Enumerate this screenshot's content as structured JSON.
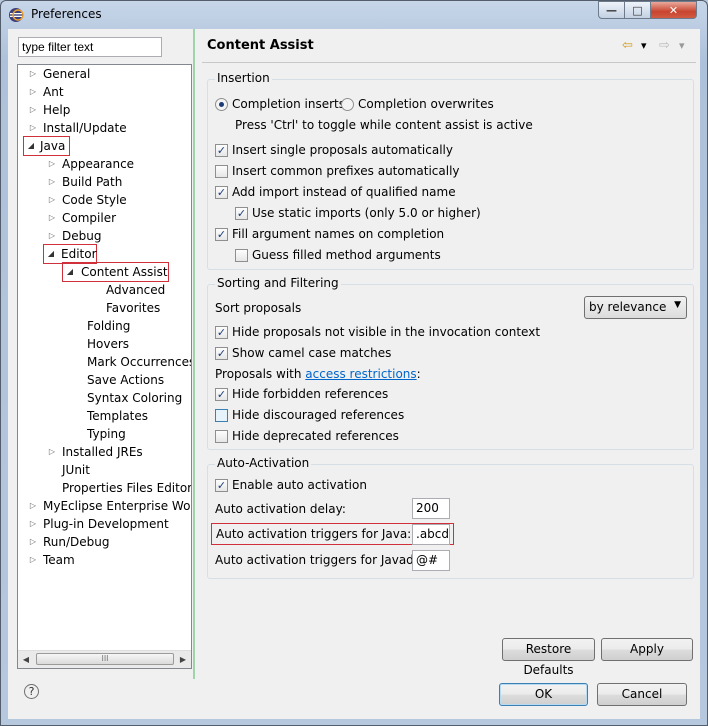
{
  "window": {
    "title": "Preferences",
    "minimize": "—",
    "maximize": "□",
    "close": "✕"
  },
  "filter": {
    "placeholder": "type filter text"
  },
  "tree": {
    "general": "General",
    "ant": "Ant",
    "help": "Help",
    "install_update": "Install/Update",
    "java": "Java",
    "appearance": "Appearance",
    "build_path": "Build Path",
    "code_style": "Code Style",
    "compiler": "Compiler",
    "debug": "Debug",
    "editor": "Editor",
    "content_assist": "Content Assist",
    "advanced": "Advanced",
    "favorites": "Favorites",
    "folding": "Folding",
    "hovers": "Hovers",
    "mark_occurrences": "Mark Occurrences",
    "save_actions": "Save Actions",
    "syntax_coloring": "Syntax Coloring",
    "templates": "Templates",
    "typing": "Typing",
    "installed_jres": "Installed JREs",
    "junit": "JUnit",
    "properties_files_editor": "Properties Files Editor",
    "myeclipse": "MyEclipse Enterprise Workbe",
    "plugin_development": "Plug-in Development",
    "run_debug": "Run/Debug",
    "team": "Team",
    "scroll_grip": "III"
  },
  "page": {
    "title": "Content Assist",
    "back": "⇦",
    "forward": "⇨",
    "menu": "▾"
  },
  "insertion": {
    "heading": "Insertion",
    "completion_inserts": "Completion inserts",
    "completion_overwrites": "Completion overwrites",
    "toggle_hint": "Press 'Ctrl' to toggle while content assist is active",
    "insert_single": "Insert single proposals automatically",
    "insert_common": "Insert common prefixes automatically",
    "add_import": "Add import instead of qualified name",
    "static_imports": "Use static imports (only 5.0 or higher)",
    "fill_args": "Fill argument names on completion",
    "guess_args": "Guess filled method arguments"
  },
  "sorting": {
    "heading": "Sorting and Filtering",
    "sort_proposals": "Sort proposals",
    "sort_value": "by relevance",
    "hide_not_visible": "Hide proposals not visible in the invocation context",
    "camel_case": "Show camel case matches",
    "proposals_with": "Proposals with",
    "access_link": "access restrictions",
    "colon": ":",
    "hide_forbidden": "Hide forbidden references",
    "hide_discouraged": "Hide discouraged references",
    "hide_deprecated": "Hide deprecated references"
  },
  "auto": {
    "heading": "Auto-Activation",
    "enable": "Enable auto activation",
    "delay_label": "Auto activation delay:",
    "delay_value": "200",
    "java_label": "Auto activation triggers for Java:",
    "java_value": ".abcdefghijklmnopqrstuvwxyz",
    "javadoc_label": "Auto activation triggers for Javadoc:",
    "javadoc_value": "@#"
  },
  "buttons": {
    "restore": "Restore Defaults",
    "apply": "Apply",
    "ok": "OK",
    "cancel": "Cancel",
    "help": "?"
  },
  "colors": {
    "highlight_box": "#d0303a",
    "link": "#0066cc",
    "check": "#1c3c78"
  }
}
